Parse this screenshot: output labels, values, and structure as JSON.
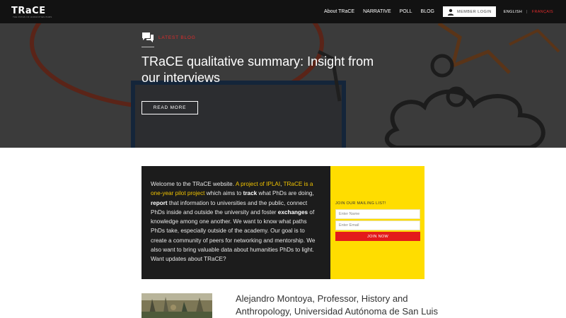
{
  "header": {
    "logo": "TRaCE",
    "logo_tagline": "THE PATHS OF HUMANITIES PHDS",
    "nav": [
      "About TRaCE",
      "NARRATIVE",
      "POLL",
      "BLOG"
    ],
    "member_login": "MEMBER LOGIN",
    "lang_en": "ENGLISH",
    "lang_sep": "|",
    "lang_fr": "FRANÇAIS"
  },
  "hero": {
    "label": "LATEST BLOG",
    "title": "TRaCE qualitative summary: Insight from our interviews",
    "read_more": "READ MORE"
  },
  "welcome": {
    "p1": "Welcome to the TRaCE website. ",
    "hl1": "A project of IPLAI",
    "p2": ", ",
    "hl2": "TRaCE is a one-year pilot project",
    "p3": " which aims to ",
    "b1": "track",
    "p4": " what PhDs are doing, ",
    "b2": "report",
    "p5": " that information to universities and the public, connect PhDs inside and outside the university and foster ",
    "b3": "exchanges",
    "p6": " of knowledge among one another. We want to know what paths PhDs take, especially outside of the academy. Our goal is to create a community of peers for networking and mentorship. We also want to bring valuable data about humanities PhDs to light. Want updates about TRaCE?"
  },
  "mailing": {
    "title": "JOIN OUR MAILING LIST!",
    "name_placeholder": "Enter Name",
    "email_placeholder": "Enter Email",
    "join": "JOIN NOW"
  },
  "post": {
    "title": "Alejandro Montoya, Professor, History and Anthropology, Universidad Autónoma de San Luis"
  },
  "colors": {
    "accent_red": "#e02b2b",
    "yellow": "#ffdd00",
    "dark": "#1c1c1c"
  }
}
